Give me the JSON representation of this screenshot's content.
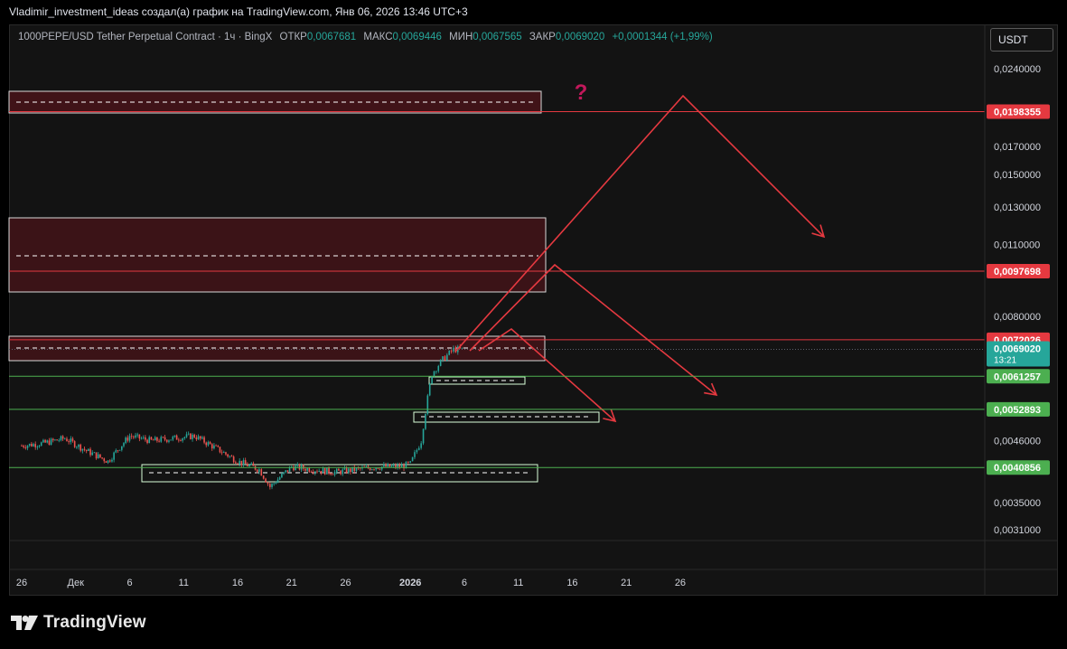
{
  "header": {
    "title": "Vladimir_investment_ideas создал(а) график на TradingView.com, Янв 06, 2026 13:46 UTC+3"
  },
  "legend": {
    "symbol": "1000PEPE/USD Tether Perpetual Contract · 1ч · BingX",
    "open_label": "ОТКР",
    "open": "0,0067681",
    "high_label": "МАКС",
    "high": "0,0069446",
    "low_label": "МИН",
    "low": "0,0067565",
    "close_label": "ЗАКР",
    "close": "0,0069020",
    "change": "+0,0001344 (+1,99%)"
  },
  "currency_button": "USDT",
  "branding": {
    "name": "TradingView"
  },
  "colors": {
    "background": "#131313",
    "up": "#26a69a",
    "down": "#ef5350",
    "resistance": "#e53940",
    "support": "#4caf50"
  },
  "chart_data": {
    "type": "line",
    "title": "",
    "ylabel": "",
    "xlabel": "",
    "y_scale": "log",
    "ylim": [
      0.0028,
      0.026
    ],
    "x_ticks": [
      "26",
      "Дек",
      "6",
      "11",
      "16",
      "21",
      "26",
      "2026",
      "6",
      "11",
      "16",
      "21",
      "26"
    ],
    "y_ticks": [
      "0,0240000",
      "0,0170000",
      "0,0150000",
      "0,0130000",
      "0,0110000",
      "0,0080000",
      "0,0046000",
      "0,0035000",
      "0,0031000"
    ],
    "series": [
      {
        "x": [
          "2025-11-26",
          "2025-11-28",
          "2025-11-30",
          "2025-12-02",
          "2025-12-04",
          "2025-12-06",
          "2025-12-08",
          "2025-12-10",
          "2025-12-12",
          "2025-12-14",
          "2025-12-16",
          "2025-12-18",
          "2025-12-19",
          "2025-12-21",
          "2025-12-23",
          "2025-12-25",
          "2025-12-27",
          "2025-12-29",
          "2025-12-31",
          "2026-01-01",
          "2026-01-02",
          "2026-01-03",
          "2026-01-04",
          "2026-01-05",
          "2026-01-06"
        ],
        "values": [
          0.0045,
          0.00455,
          0.00465,
          0.0044,
          0.0042,
          0.0047,
          0.0046,
          0.00465,
          0.0047,
          0.00445,
          0.0042,
          0.00405,
          0.00375,
          0.0041,
          0.00405,
          0.004,
          0.00405,
          0.0041,
          0.0041,
          0.00415,
          0.0046,
          0.0062,
          0.0066,
          0.0069,
          0.0069
        ]
      }
    ],
    "price_labels": [
      {
        "value": "0,0198355",
        "kind": "resistance"
      },
      {
        "value": "0,0097698",
        "kind": "resistance"
      },
      {
        "value": "0,0072026",
        "kind": "resistance"
      },
      {
        "value": "0,0069020",
        "kind": "current",
        "countdown": "13:21"
      },
      {
        "value": "0,0061257",
        "kind": "support"
      },
      {
        "value": "0,0052893",
        "kind": "support"
      },
      {
        "value": "0,0040856",
        "kind": "support"
      }
    ],
    "annotations": [
      "?"
    ],
    "grid": false,
    "legend_position": "top-left"
  }
}
